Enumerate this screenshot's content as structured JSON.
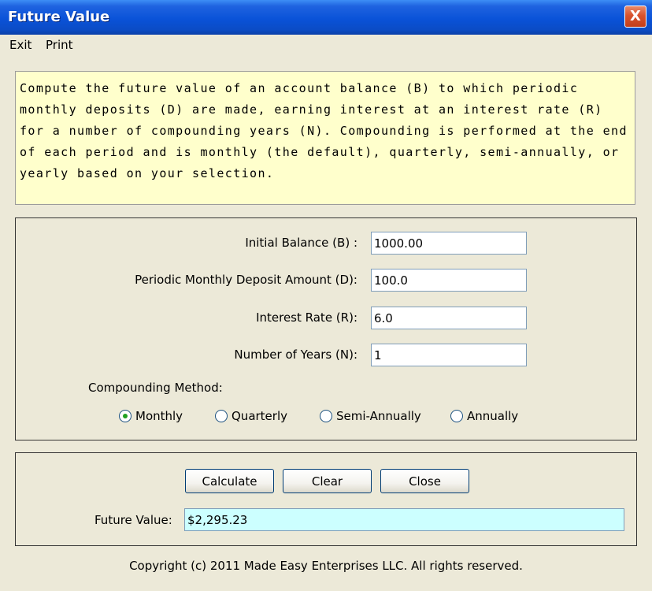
{
  "window": {
    "title": "Future Value",
    "close_label": "X"
  },
  "menu": {
    "items": [
      "Exit",
      "Print"
    ]
  },
  "description": "Compute the future value of an account balance (B) to which periodic monthly deposits (D) are made, earning interest at an interest rate (R) for a number of compounding years (N). Compounding is performed at the end of each period and is monthly (the default), quarterly, semi-annually, or yearly based on your selection.",
  "inputs": {
    "initial_balance": {
      "label": "Initial Balance (B) :",
      "value": "1000.00"
    },
    "monthly_deposit": {
      "label": "Periodic Monthly Deposit Amount (D):",
      "value": "100.0"
    },
    "interest_rate": {
      "label": "Interest Rate (R):",
      "value": "6.0"
    },
    "years": {
      "label": "Number of Years  (N):",
      "value": "1"
    }
  },
  "compounding": {
    "label": "Compounding Method:",
    "options": [
      "Monthly",
      "Quarterly",
      "Semi-Annually",
      "Annually"
    ],
    "selected": "Monthly"
  },
  "actions": {
    "calculate": "Calculate",
    "clear": "Clear",
    "close": "Close"
  },
  "result": {
    "label": "Future Value:",
    "value": "$2,295.23"
  },
  "footer": {
    "copyright": "Copyright (c) 2011 Made Easy Enterprises LLC. All rights reserved."
  },
  "colors": {
    "description_bg": "#FFFFCC",
    "result_bg": "#CCFFFF",
    "titlebar": "#0A52D8"
  }
}
